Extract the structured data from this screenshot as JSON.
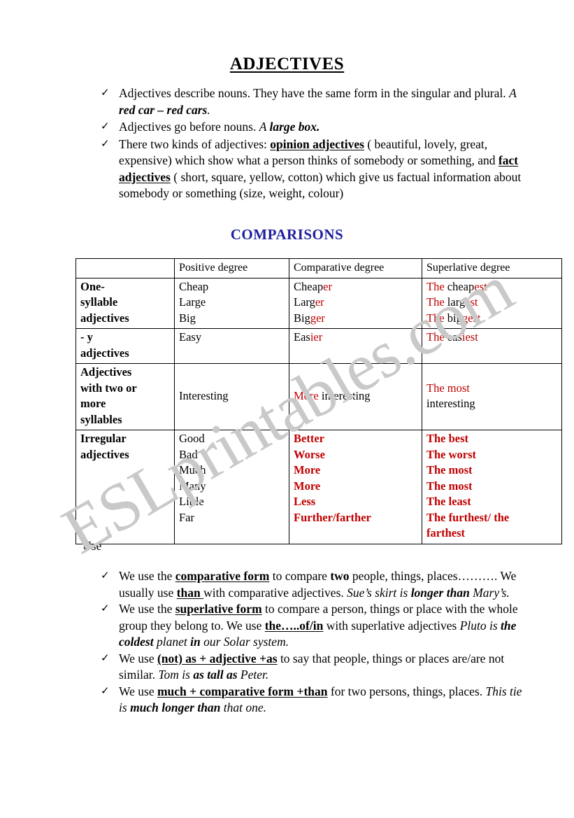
{
  "document": {
    "title": "ADJECTIVES",
    "watermark": "ESLprintables.com",
    "comparisons_heading": "COMPARISONS",
    "use_label": "Use",
    "colors": {
      "heading_blue": "#1F1F9F",
      "accent_red": "#C00000",
      "watermark_gray": "#C9C9C9",
      "text_black": "#000000"
    }
  },
  "intro_bullets": [
    {
      "icon": "check-mark",
      "parts": [
        {
          "text": "Adjectives describe nouns. They have the same form in the singular and plural.  ",
          "style": "normal"
        },
        {
          "text": "A ",
          "style": "italic"
        },
        {
          "text": "red car – red cars",
          "style": "bold-italic"
        },
        {
          "text": ".",
          "style": "italic"
        }
      ]
    },
    {
      "icon": "check-mark",
      "parts": [
        {
          "text": "Adjectives go before nouns. ",
          "style": "normal"
        },
        {
          "text": "A ",
          "style": "italic"
        },
        {
          "text": "large box.",
          "style": "bold-italic"
        }
      ]
    },
    {
      "icon": "check-mark",
      "parts": [
        {
          "text": "There two kinds of adjectives: ",
          "style": "normal"
        },
        {
          "text": "opinion adjectives",
          "style": "bold-underline"
        },
        {
          "text": " ( beautiful, lovely, great, expensive) which show what a person thinks of somebody or something, and ",
          "style": "normal"
        },
        {
          "text": "fact adjectives",
          "style": "bold-underline"
        },
        {
          "text": " ( short, square, yellow, cotton) which give us factual information about somebody or something (size, weight, colour)",
          "style": "normal"
        }
      ]
    }
  ],
  "table": {
    "headers": [
      "",
      "Positive degree",
      "Comparative degree",
      "Superlative degree"
    ],
    "rows": [
      {
        "category": "One-syllable adjectives",
        "category_lines": [
          "One-",
          "syllable",
          "adjectives"
        ],
        "positive": [
          "Cheap",
          "Large",
          "Big"
        ],
        "comparative": [
          {
            "stem": "Cheap",
            "suffix": "er"
          },
          {
            "stem": "Larg",
            "suffix": "er"
          },
          {
            "stem": "Big",
            "suffix": "ger"
          }
        ],
        "superlative": [
          {
            "prefix": "The ",
            "stem": "cheap",
            "suffix": "est"
          },
          {
            "prefix": "The ",
            "stem": "larg",
            "suffix": "est"
          },
          {
            "prefix": "The ",
            "stem": "big",
            "suffix": "gest"
          }
        ]
      },
      {
        "category": "- y adjectives",
        "category_lines": [
          "- y",
          "adjectives"
        ],
        "positive": [
          "Easy"
        ],
        "comparative": [
          {
            "stem": "Eas",
            "suffix": "ier"
          }
        ],
        "superlative": [
          {
            "prefix": "The ",
            "stem": "eas",
            "suffix": "iest"
          }
        ]
      },
      {
        "category": "Adjectives with two or more syllables",
        "category_lines": [
          "Adjectives",
          "with two or",
          "more",
          "syllables"
        ],
        "positive": [
          "Interesting"
        ],
        "comparative": [
          {
            "prefix_red": "More",
            "rest": " interesting"
          }
        ],
        "superlative": [
          {
            "prefix_red": "The most",
            "rest_line2": "interesting"
          }
        ]
      },
      {
        "category": "Irregular adjectives",
        "category_lines": [
          "Irregular",
          "adjectives"
        ],
        "positive": [
          "Good",
          "Bad",
          "Much",
          "Many",
          "Little",
          "Far"
        ],
        "comparative_bold_red": [
          "Better",
          "Worse",
          "More",
          "More",
          "Less",
          "Further/farther"
        ],
        "superlative_bold_red": [
          "The best",
          "The worst",
          "The most",
          "The most",
          "The least",
          "The furthest/ the farthest"
        ]
      }
    ]
  },
  "use_bullets": [
    {
      "icon": "check-mark",
      "parts": [
        {
          "text": "We use the ",
          "style": "normal"
        },
        {
          "text": "comparative form",
          "style": "bold-underline"
        },
        {
          "text": " to compare ",
          "style": "normal"
        },
        {
          "text": "two",
          "style": "bold"
        },
        {
          "text": " people, things, places………. We usually use ",
          "style": "normal"
        },
        {
          "text": "than ",
          "style": "bold-underline"
        },
        {
          "text": "with comparative adjectives. ",
          "style": "normal"
        },
        {
          "text": "Sue’s skirt is ",
          "style": "italic"
        },
        {
          "text": "longer than",
          "style": "bold-italic"
        },
        {
          "text": " Mary’s.",
          "style": "italic"
        }
      ]
    },
    {
      "icon": "check-mark",
      "parts": [
        {
          "text": "We use the ",
          "style": "normal"
        },
        {
          "text": "superlative form",
          "style": "bold-underline"
        },
        {
          "text": " to compare a person, things or place with the whole group they belong to. We use ",
          "style": "normal"
        },
        {
          "text": "the…..of/in",
          "style": "bold-underline"
        },
        {
          "text": " with superlative adjectives ",
          "style": "normal"
        },
        {
          "text": "Pluto is ",
          "style": "italic"
        },
        {
          "text": "the coldest",
          "style": "bold-italic"
        },
        {
          "text": " planet ",
          "style": "italic"
        },
        {
          "text": "in",
          "style": "bold-italic"
        },
        {
          "text": " our Solar system.",
          "style": "italic"
        }
      ]
    },
    {
      "icon": "check-mark",
      "parts": [
        {
          "text": "We use ",
          "style": "normal"
        },
        {
          "text": "(not) as + adjective +as",
          "style": "bold-underline"
        },
        {
          "text": " to say that people, things or places are/are not similar. ",
          "style": "normal"
        },
        {
          "text": "Tom is ",
          "style": "italic"
        },
        {
          "text": "as tall as",
          "style": "bold-italic"
        },
        {
          "text": " Peter.",
          "style": "italic"
        }
      ]
    },
    {
      "icon": "check-mark",
      "parts": [
        {
          "text": "We use ",
          "style": "normal"
        },
        {
          "text": "much + comparative form +than",
          "style": "bold-underline"
        },
        {
          "text": " for two persons, things, places. ",
          "style": "normal"
        },
        {
          "text": "This tie is ",
          "style": "italic"
        },
        {
          "text": "much longer than",
          "style": "bold-italic"
        },
        {
          "text": " that one.",
          "style": "italic"
        }
      ]
    }
  ]
}
